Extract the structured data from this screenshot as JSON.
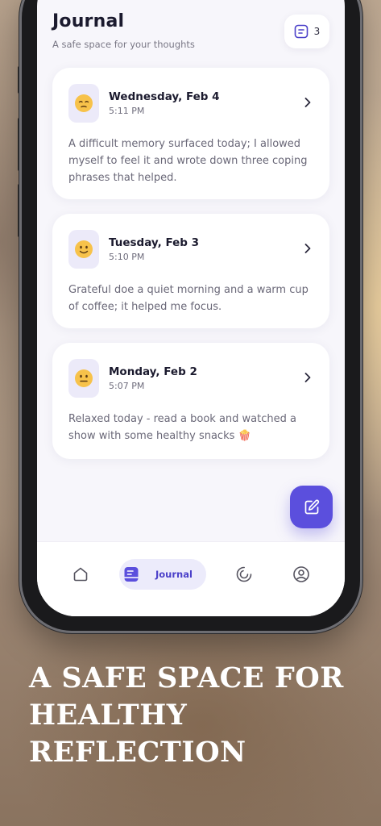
{
  "header": {
    "title": "Journal",
    "subtitle": "A safe space for your thoughts",
    "entry_count": "3",
    "entry_count_icon": "journal-icon"
  },
  "entries": [
    {
      "mood": "relieved",
      "emoji": "😔",
      "date": "Wednesday, Feb 4",
      "time": "5:11 PM",
      "text": "A difficult memory surfaced today; I allowed myself to feel it and wrote down three coping phrases that helped."
    },
    {
      "mood": "slight-smile",
      "emoji": "🙂",
      "date": "Tuesday, Feb 3",
      "time": "5:10 PM",
      "text": "Grateful doe a quiet morning and a warm cup of coffee; it helped me focus."
    },
    {
      "mood": "neutral",
      "emoji": "😐",
      "date": "Monday, Feb 2",
      "time": "5:07 PM",
      "text": "Relaxed today - read a book and watched a show with some healthy snacks 🍿"
    }
  ],
  "fab": {
    "icon": "edit-icon"
  },
  "nav": {
    "items": [
      {
        "icon": "home-icon"
      },
      {
        "icon": "journal-icon",
        "label": "Journal",
        "active": true
      },
      {
        "icon": "progress-icon"
      },
      {
        "icon": "profile-icon"
      }
    ]
  },
  "promo": {
    "line1": "A SAFE SPACE FOR",
    "line2": "HEALTHY",
    "line3": "REFLECTION"
  },
  "colors": {
    "accent": "#5b4fdd",
    "accent_soft": "#ecebfb",
    "screen_bg": "#f7f6fb",
    "title": "#1b1a2e"
  }
}
